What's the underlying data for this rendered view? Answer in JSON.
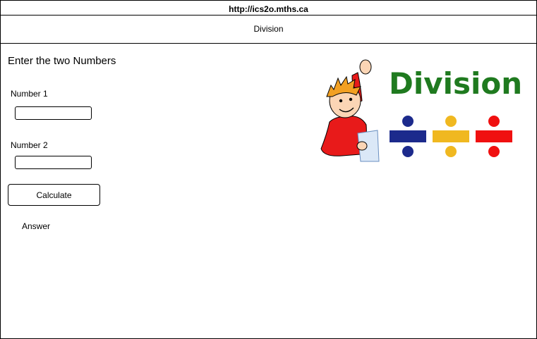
{
  "browser": {
    "url": "http://ics2o.mths.ca"
  },
  "page": {
    "title": "Division",
    "heading": "Enter the two Numbers",
    "number1_label": "Number 1",
    "number1_value": "",
    "number2_label": "Number 2",
    "number2_value": "",
    "calculate_label": "Calculate",
    "answer_text": "Answer"
  },
  "illustration": {
    "word": "Division",
    "word_color": "#1f7a1f",
    "symbol_colors": [
      "#1c2a8c",
      "#f0b820",
      "#f01010"
    ]
  }
}
